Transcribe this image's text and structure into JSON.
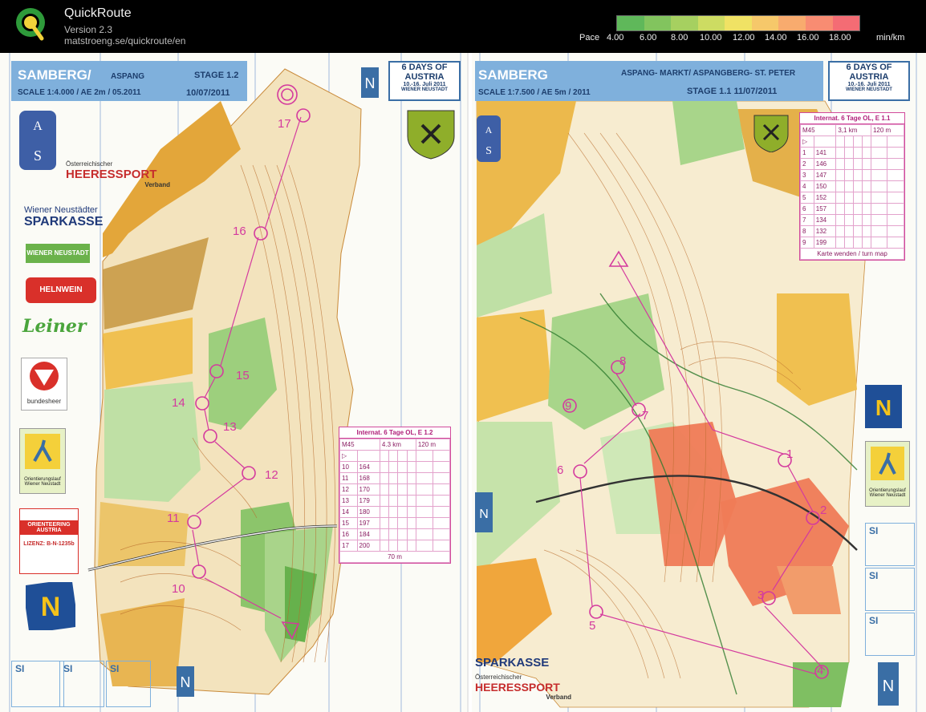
{
  "app": {
    "title": "QuickRoute",
    "version": "Version 2.3",
    "url": "matstroeng.se/quickroute/en"
  },
  "pace": {
    "label": "Pace",
    "ticks": [
      "4.00",
      "6.00",
      "8.00",
      "10.00",
      "12.00",
      "14.00",
      "16.00",
      "18.00"
    ],
    "unit": "min/km",
    "colors": [
      "#5fb85a",
      "#82c45e",
      "#a6d060",
      "#cddc62",
      "#f0e264",
      "#f6c86a",
      "#f8ab6e",
      "#f88c72",
      "#f46c74"
    ]
  },
  "left_map": {
    "title": "SAMBERG/",
    "title_small": "ASPANG",
    "stage": "STAGE 1.2",
    "scale": "SCALE 1:4.000 / AE 2m / 05.2011",
    "date": "10/07/2011",
    "days_top": "6 DAYS OF",
    "days_mid": "AUSTRIA",
    "days_dates": "10.-16. Juli 2011",
    "days_city": "WIENER NEUSTADT",
    "sponsors": {
      "heeres_small": "Österreichischer",
      "heeres": "HEERESSPORT",
      "heeres_sub": "Verband",
      "wn": "Wiener Neustädter",
      "sparkasse": "SPARKASSE",
      "wiener": "WIENER NEUSTADT",
      "helnwein": "HELNWEIN",
      "leiner": "Leiner",
      "bundesheer": "bundesheer",
      "ol": "Orientierungslauf Wiener Neustadt",
      "lizenz": "LIZENZ: B-N-1235b",
      "oa": "ORIENTEERING AUSTRIA"
    },
    "controls": [
      "10",
      "11",
      "12",
      "13",
      "14",
      "15",
      "16",
      "17"
    ],
    "description": {
      "header": "Internat. 6 Tage OL, E 1.2",
      "class": "M45",
      "length": "4.3 km",
      "climb": "120 m",
      "rows": [
        [
          "10",
          "164"
        ],
        [
          "11",
          "168"
        ],
        [
          "12",
          "170"
        ],
        [
          "13",
          "179"
        ],
        [
          "14",
          "180"
        ],
        [
          "15",
          "197"
        ],
        [
          "16",
          "184"
        ],
        [
          "17",
          "200"
        ]
      ],
      "finish": "70 m"
    },
    "si_labels": [
      "SI",
      "SI",
      "SI"
    ]
  },
  "right_map": {
    "title": "SAMBERG",
    "subtitle": "ASPANG- MARKT/ ASPANGBERG- ST. PETER",
    "scale": "SCALE 1:7.500 / AE 5m / 2011",
    "stage": "STAGE 1.1  11/07/2011",
    "days_top": "6 DAYS OF",
    "days_mid": "AUSTRIA",
    "days_dates": "10.-16. Juli 2011",
    "days_city": "WIENER NEUSTADT",
    "controls": [
      "1",
      "2",
      "3",
      "4",
      "5",
      "6",
      "7",
      "8",
      "9"
    ],
    "description": {
      "header": "Internat. 6 Tage OL, E 1.1",
      "class": "M45",
      "length": "3,1 km",
      "climb": "120 m",
      "rows": [
        [
          "1",
          "141"
        ],
        [
          "2",
          "146"
        ],
        [
          "3",
          "147"
        ],
        [
          "4",
          "150"
        ],
        [
          "5",
          "152"
        ],
        [
          "6",
          "157"
        ],
        [
          "7",
          "134"
        ],
        [
          "8",
          "132"
        ],
        [
          "9",
          "199"
        ]
      ],
      "footer": "Karte wenden / turn map"
    },
    "sponsors": {
      "sparkasse": "SPARKASSE",
      "heeres_small": "Österreichischer",
      "heeres": "HEERESSPORT",
      "heeres_sub": "Verband",
      "ol": "Orientierungslauf Wiener Neustadt"
    },
    "si_labels": [
      "SI",
      "SI",
      "SI"
    ]
  }
}
